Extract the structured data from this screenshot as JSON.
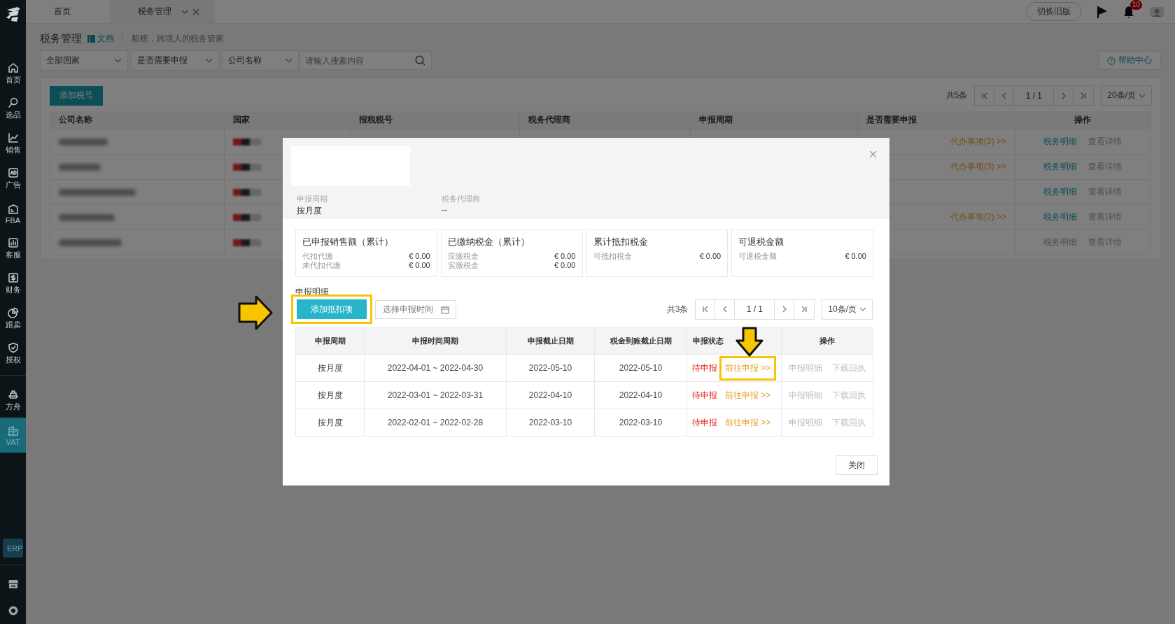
{
  "sidebar": {
    "main_items": [
      {
        "label": "首页",
        "selected": false
      },
      {
        "label": "选品",
        "selected": false
      },
      {
        "label": "销售",
        "selected": false
      },
      {
        "label": "广告",
        "selected": false
      },
      {
        "label": "FBA",
        "selected": false
      },
      {
        "label": "客服",
        "selected": false
      },
      {
        "label": "财务",
        "selected": false
      },
      {
        "label": "跟卖",
        "selected": false
      },
      {
        "label": "授权",
        "selected": false
      }
    ],
    "app_items": [
      {
        "label": "方舟",
        "selected": false
      },
      {
        "label": "VAT",
        "selected": true
      }
    ],
    "erp_button": "ERP"
  },
  "tabs": [
    {
      "label": "首页",
      "selected": false
    },
    {
      "label": "税务管理",
      "selected": true
    }
  ],
  "header": {
    "switch_button": "切换旧版",
    "notification_count": "10"
  },
  "page": {
    "title": "税务管理",
    "doc_link": "文档",
    "subtitle": "船税，跨境人的税务管家",
    "filters": [
      "全部国家",
      "是否需要申报",
      "公司名称"
    ],
    "search_placeholder": "请输入搜索内容",
    "help_button": "帮助中心"
  },
  "table": {
    "add_button": "添加税号",
    "total": "共5条",
    "page": "1 / 1",
    "page_size": "20条/页",
    "columns": [
      "公司名称",
      "国家",
      "报税税号",
      "税务代理商",
      "申报周期",
      "是否需要申报",
      "操作"
    ],
    "rows": [
      {
        "todo": "代办事项(2) >>",
        "actions": [
          {
            "label": "税务明细",
            "disabled": false
          },
          {
            "label": "查看详情",
            "disabled": true
          }
        ]
      },
      {
        "todo": "代办事项(3) >>",
        "actions": [
          {
            "label": "税务明细",
            "disabled": false
          },
          {
            "label": "查看详情",
            "disabled": true
          }
        ]
      },
      {
        "actions": [
          {
            "label": "税务明细",
            "disabled": false
          },
          {
            "label": "查看详情",
            "disabled": true
          }
        ]
      },
      {
        "todo": "代办事项(2) >>",
        "actions": [
          {
            "label": "税务明细",
            "disabled": false
          },
          {
            "label": "查看详情",
            "disabled": true
          }
        ]
      },
      {
        "actions": [
          {
            "label": "税务明细",
            "disabled": true
          },
          {
            "label": "查看详情",
            "disabled": true
          }
        ]
      }
    ]
  },
  "modal": {
    "info": [
      {
        "label": "申报周期",
        "value": "按月度"
      },
      {
        "label": "税务代理商",
        "value": "--"
      }
    ],
    "cards": [
      {
        "title": "已申报销售额（累计）",
        "lines": [
          {
            "label": "代扣代缴",
            "value": "€ 0.00"
          },
          {
            "label": "未代扣代缴",
            "value": "€ 0.00"
          }
        ]
      },
      {
        "title": "已缴纳税金（累计）",
        "lines": [
          {
            "label": "应缴税金",
            "value": "€ 0.00"
          },
          {
            "label": "实缴税金",
            "value": "€ 0.00"
          }
        ]
      },
      {
        "title": "累计抵扣税金",
        "lines": [
          {
            "label": "可抵扣税金",
            "value": "€ 0.00"
          }
        ]
      },
      {
        "title": "可退税金额",
        "lines": [
          {
            "label": "可退税金额",
            "value": "€ 0.00"
          }
        ]
      }
    ],
    "section_title": "申报明细",
    "add_button": {
      "label": "添加抵扣项",
      "highlighted": true
    },
    "date_placeholder": "选择申报时间",
    "total": "共3条",
    "page": "1 / 1",
    "page_size": "10条/页",
    "columns": [
      "申报周期",
      "申报时间周期",
      "申报截止日期",
      "税金到账截止日期",
      "申报状态",
      "操作"
    ],
    "rows": [
      {
        "cycle": "按月度",
        "period": "2022-04-01 ~ 2022-04-30",
        "deadline": "2022-05-10",
        "tax_deadline": "2022-05-10",
        "status": "待申报",
        "go_link": "前往申报 >>",
        "highlighted": true,
        "actions": [
          {
            "label": "申报明细",
            "disabled": true
          },
          {
            "label": "下载回执",
            "disabled": true
          }
        ]
      },
      {
        "cycle": "按月度",
        "period": "2022-03-01 ~ 2022-03-31",
        "deadline": "2022-04-10",
        "tax_deadline": "2022-04-10",
        "status": "待申报",
        "go_link": "前往申报 >>",
        "highlighted": false,
        "actions": [
          {
            "label": "申报明细",
            "disabled": true
          },
          {
            "label": "下载回执",
            "disabled": true
          }
        ]
      },
      {
        "cycle": "按月度",
        "period": "2022-02-01 ~ 2022-02-28",
        "deadline": "2022-03-10",
        "tax_deadline": "2022-03-10",
        "status": "待申报",
        "go_link": "前往申报 >>",
        "highlighted": false,
        "actions": [
          {
            "label": "申报明细",
            "disabled": true
          },
          {
            "label": "下载回执",
            "disabled": true
          }
        ]
      }
    ],
    "close_button": "关闭"
  }
}
